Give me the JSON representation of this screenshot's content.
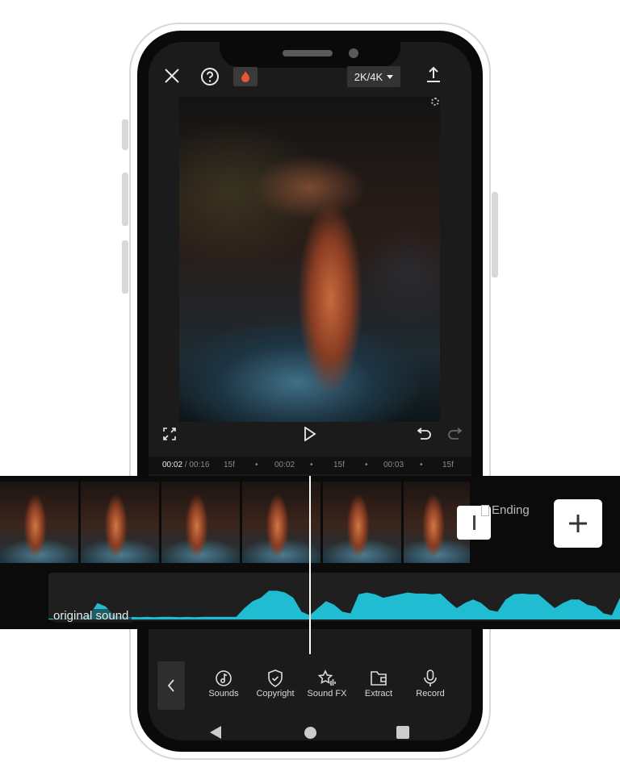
{
  "header": {
    "resolution_label": "2K/4K"
  },
  "timeline": {
    "current_time": "00:02",
    "separator": " / ",
    "total_time": "00:16",
    "ruler_ticks": [
      "15f",
      "•",
      "00:02",
      "•",
      "15f",
      "•",
      "00:03",
      "•",
      "15f"
    ],
    "ending_label": "Ending",
    "audio_track_label": "original sound",
    "waveform_levels": [
      0,
      0,
      0,
      0,
      0,
      0.1,
      0.45,
      0.35,
      0.1,
      0.05,
      0.05,
      0.04,
      0.05,
      0.04,
      0.05,
      0.05,
      0.04,
      0.05,
      0.04,
      0.05,
      0.05,
      0.05,
      0.05,
      0.05,
      0.3,
      0.5,
      0.6,
      0.8,
      0.8,
      0.75,
      0.6,
      0.2,
      0.1,
      0.3,
      0.5,
      0.4,
      0.2,
      0.15,
      0.7,
      0.75,
      0.7,
      0.6,
      0.65,
      0.7,
      0.75,
      0.72,
      0.72,
      0.7,
      0.72,
      0.5,
      0.3,
      0.45,
      0.55,
      0.45,
      0.25,
      0.2,
      0.55,
      0.7,
      0.72,
      0.7,
      0.7,
      0.5,
      0.3,
      0.45,
      0.55,
      0.55,
      0.4,
      0.35,
      0.15,
      0.1,
      0.6
    ]
  },
  "toolbar": {
    "items": [
      {
        "label": "Sounds",
        "icon": "music-note-icon"
      },
      {
        "label": "Copyright",
        "icon": "shield-check-icon"
      },
      {
        "label": "Sound FX",
        "icon": "star-sound-icon"
      },
      {
        "label": "Extract",
        "icon": "folder-icon"
      },
      {
        "label": "Record",
        "icon": "microphone-icon"
      }
    ]
  },
  "colors": {
    "waveform": "#1fbcd2",
    "flame": "#e8552f",
    "background": "#1b1b1b"
  }
}
